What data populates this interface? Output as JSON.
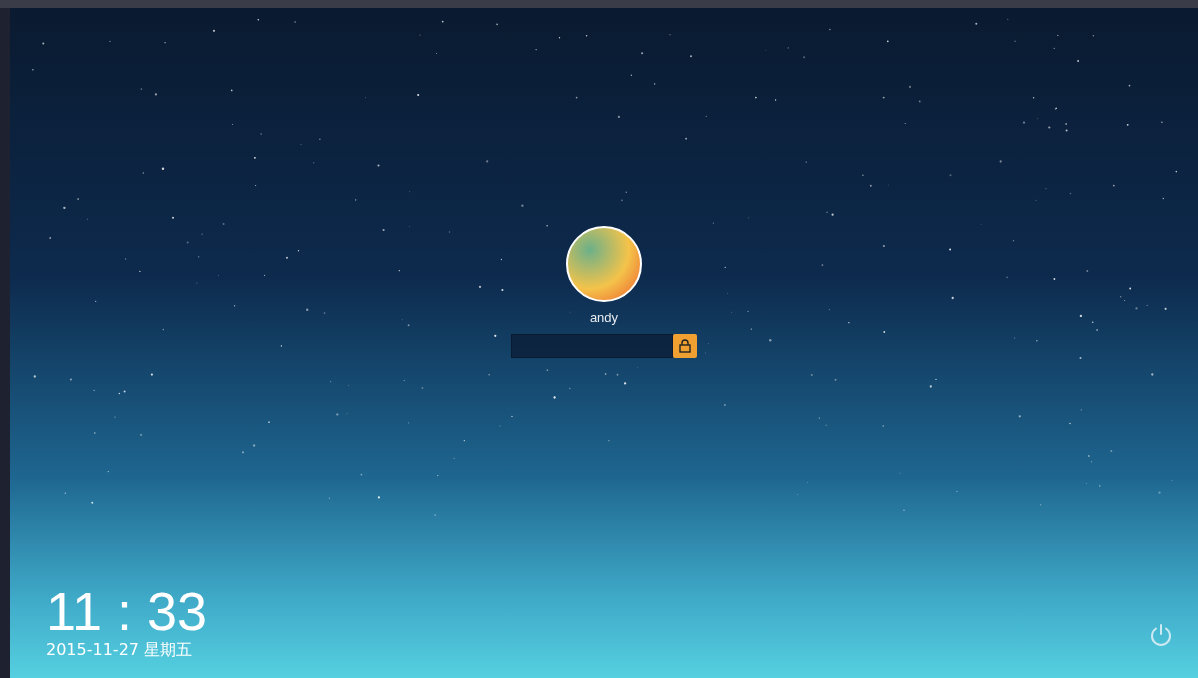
{
  "user": {
    "name": "andy"
  },
  "clock": {
    "time": "11 : 33",
    "date": "2015-11-27 星期五"
  }
}
